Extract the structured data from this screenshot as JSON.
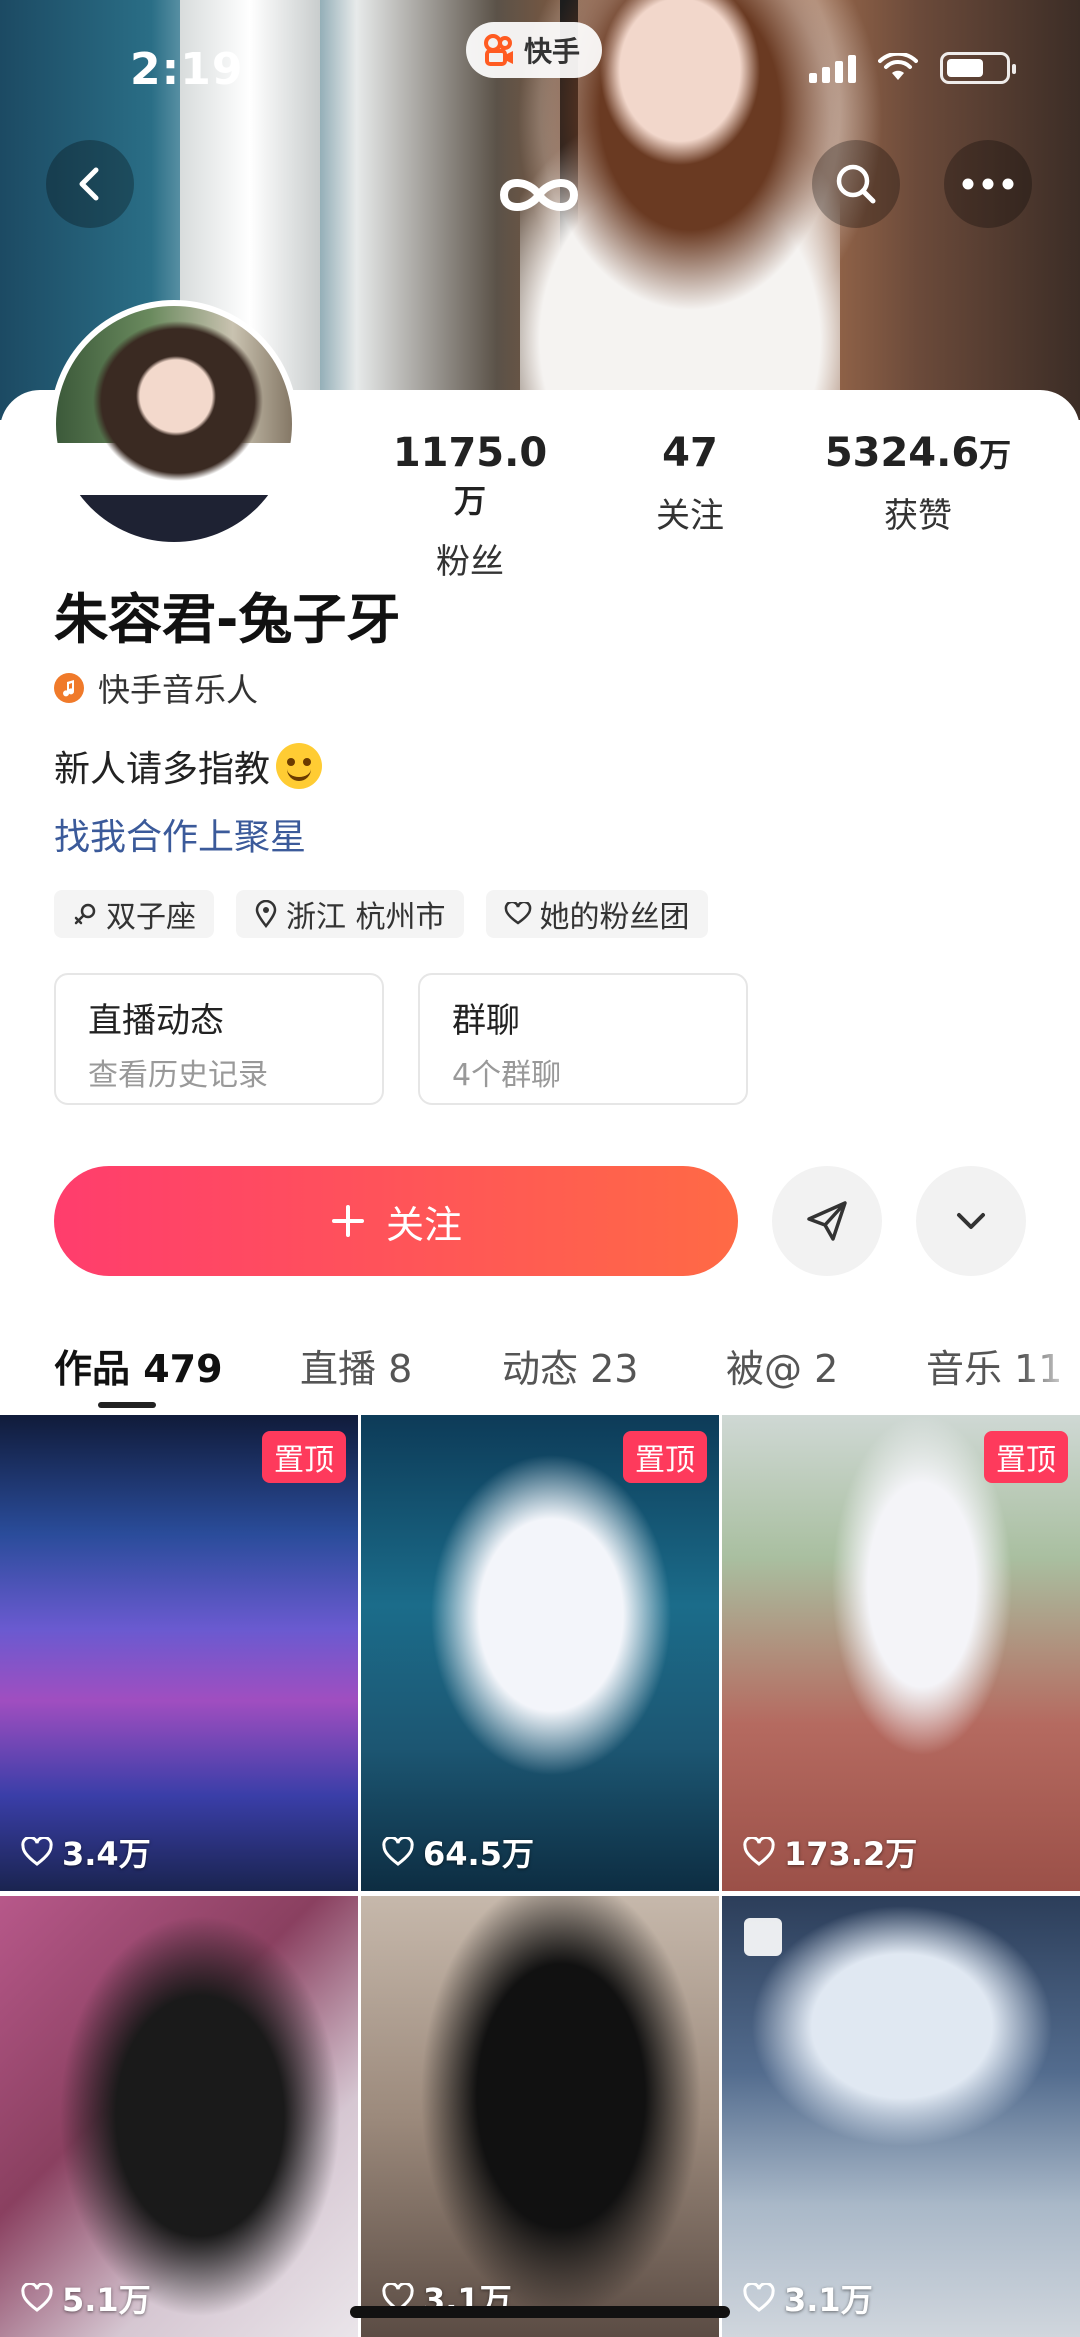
{
  "status_bar": {
    "time": "2:19"
  },
  "app_pill": {
    "label": "快手"
  },
  "profile": {
    "stats": [
      {
        "num": "1175.0",
        "unit": "万",
        "label": "粉丝"
      },
      {
        "num": "47",
        "unit": "",
        "label": "关注"
      },
      {
        "num": "5324.6",
        "unit": "万",
        "label": "获赞"
      }
    ],
    "name": "朱容君-兔子牙",
    "verified_tag": "快手音乐人",
    "bio": "新人请多指教",
    "link": "找我合作上聚星",
    "tags": [
      "双子座",
      "浙江 杭州市",
      "她的粉丝团"
    ],
    "boxes": [
      {
        "title": "直播动态",
        "subtitle": "查看历史记录"
      },
      {
        "title": "群聊",
        "subtitle": "4个群聊"
      }
    ],
    "follow_label": "关注"
  },
  "tabs": [
    "作品 479",
    "直播 8",
    "动态 23",
    "被@ 2",
    "音乐 11"
  ],
  "grid": [
    {
      "likes": "3.4万",
      "pinned": "置顶"
    },
    {
      "likes": "64.5万",
      "pinned": "置顶"
    },
    {
      "likes": "173.2万",
      "pinned": "置顶"
    },
    {
      "likes": "5.1万",
      "pinned": ""
    },
    {
      "likes": "3.1万",
      "pinned": ""
    },
    {
      "likes": "3.1万",
      "pinned": ""
    }
  ],
  "colors": {
    "accent": "#fe3a5c",
    "link": "#3b5a9a",
    "follow_start": "#ff3d6d",
    "follow_end": "#ff6a45"
  }
}
